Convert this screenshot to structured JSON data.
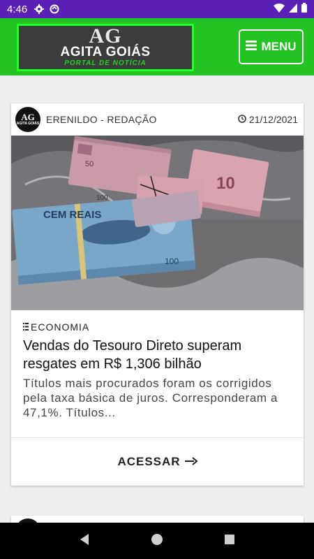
{
  "status_bar": {
    "time": "4:46"
  },
  "header": {
    "logo": {
      "monogram": "AG",
      "name": "AGITA GOIÁS",
      "tagline": "PORTAL DE NOTÍCIA"
    },
    "menu_label": "MENU"
  },
  "article": {
    "avatar_monogram": "AG",
    "avatar_name": "AGITA GOIÁS",
    "author": "ERENILDO - REDAÇÃO",
    "date": "21/12/2021",
    "category": "ECONOMIA",
    "title": "Vendas do Tesouro Direto superam resgates em R$ 1,306 bilhão",
    "excerpt": "Títulos mais procurados foram os corrigidos pela taxa básica de juros. Corresponderam a 47,1%. Títulos...",
    "button_label": "ACESSAR",
    "photo_notes": {
      "note_values": [
        "50",
        "10",
        "100",
        "100"
      ],
      "note_text": "CEM REAIS"
    }
  },
  "icons": {
    "menu": "hamburger-icon",
    "date": "clock-icon",
    "category": "list-icon",
    "arrow": "arrow-right-icon"
  }
}
